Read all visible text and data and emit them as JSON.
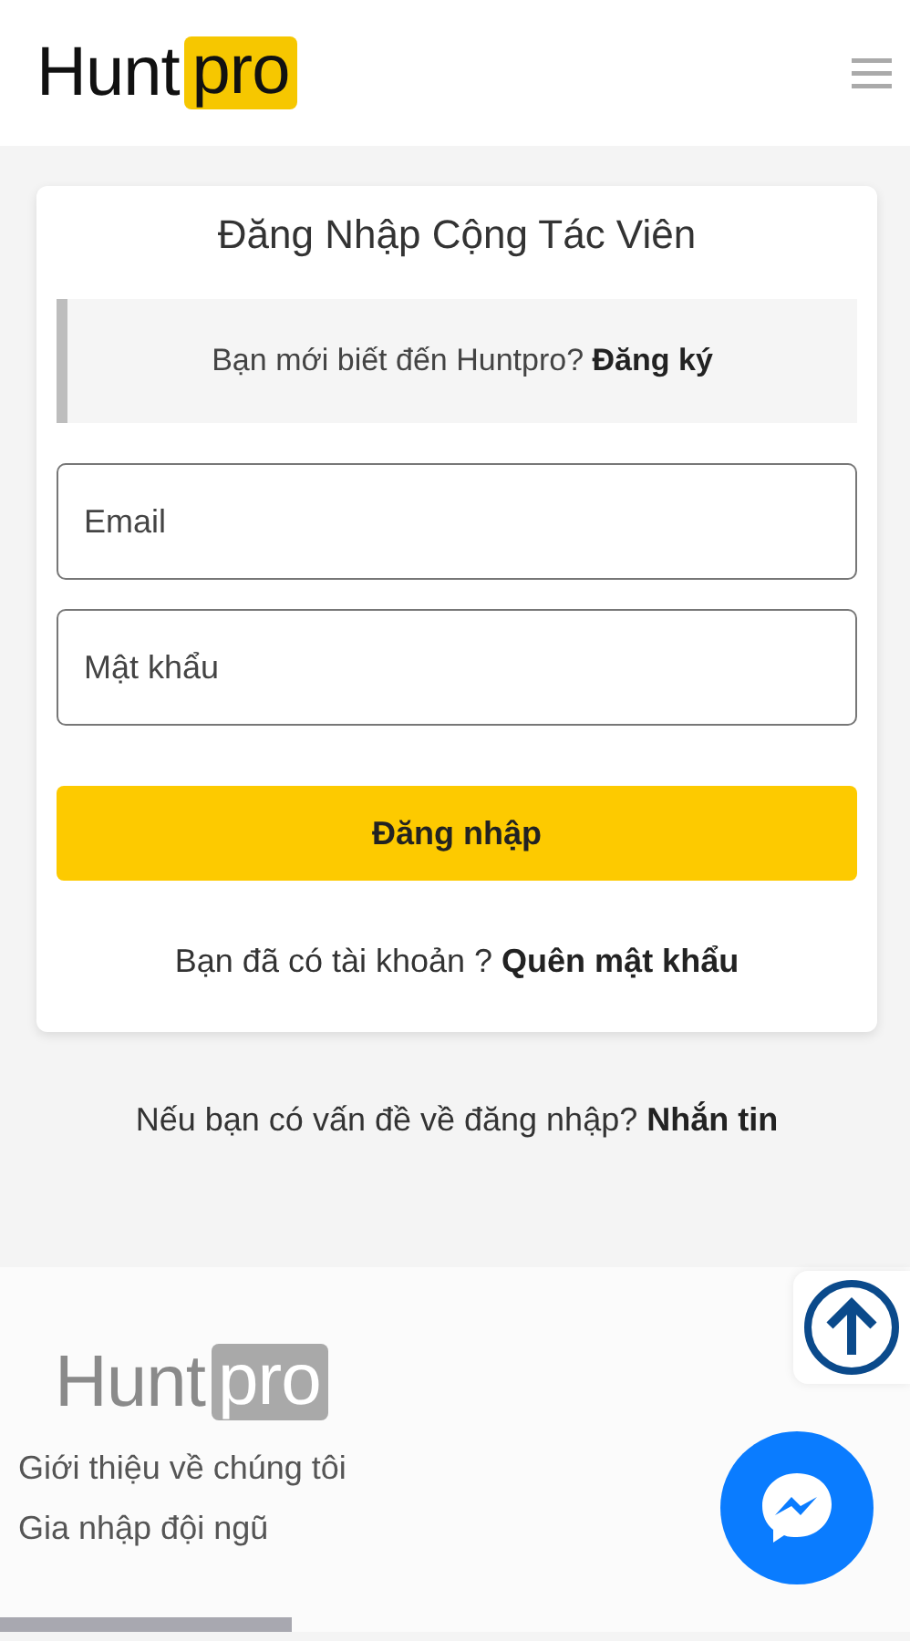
{
  "header": {
    "logo": {
      "word": "Hunt",
      "badge": "pro"
    }
  },
  "login_card": {
    "title": "Đăng Nhập Cộng Tác Viên",
    "notice": {
      "text": "Bạn mới biết đến Huntpro? ",
      "link": "Đăng ký"
    },
    "fields": [
      {
        "placeholder": "Email"
      },
      {
        "placeholder": "Mật khẩu"
      }
    ],
    "submit": "Đăng nhập",
    "forgot": {
      "text": "Bạn đã có tài khoản ? ",
      "link": "Quên mật khẩu"
    }
  },
  "help": {
    "text": "Nếu bạn có vấn đề về đăng nhập? ",
    "link": "Nhắn tin"
  },
  "footer": {
    "logo": {
      "word": "Hunt",
      "badge": "pro"
    },
    "links": [
      "Giới thiệu về chúng tôi",
      "Gia nhập đội ngũ"
    ]
  }
}
